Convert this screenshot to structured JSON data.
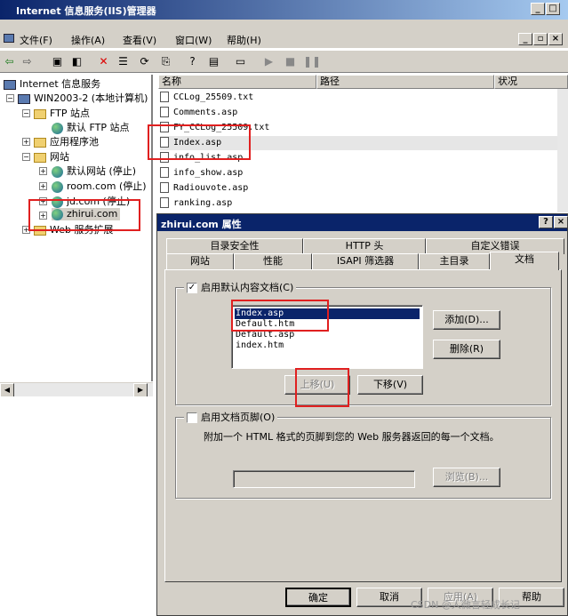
{
  "window": {
    "title": "Internet 信息服务(IIS)管理器"
  },
  "menu": [
    "文件(F)",
    "操作(A)",
    "查看(V)",
    "窗口(W)",
    "帮助(H)"
  ],
  "tree": {
    "root": "Internet 信息服务",
    "computer": "WIN2003-2 (本地计算机)",
    "ftp": "FTP 站点",
    "ftp_default": "默认 FTP 站点",
    "app_pools": "应用程序池",
    "websites": "网站",
    "sites": [
      "默认网站 (停止)",
      "room.com (停止)",
      "jd.com (停止)",
      "zhirui.com"
    ],
    "ext": "Web 服务扩展"
  },
  "list": {
    "columns": [
      "名称",
      "路径",
      "状况"
    ],
    "files": [
      "CCLog_25509.txt",
      "Comments.asp",
      "FY_CCLog_25509.txt",
      "Index.asp",
      "info_list.asp",
      "info_show.asp",
      "Radiouvote.asp",
      "ranking.asp"
    ]
  },
  "dialog": {
    "title": "zhirui.com 属性",
    "tabs_row1": [
      "目录安全性",
      "HTTP 头",
      "自定义错误"
    ],
    "tabs_row2": [
      "网站",
      "性能",
      "ISAPI 筛选器",
      "主目录",
      "文档"
    ],
    "enable_default_label": "启用默认内容文档(C)",
    "default_docs": [
      "Index.asp",
      "Default.htm",
      "Default.asp",
      "index.htm"
    ],
    "add_button": "添加(D)...",
    "remove_button": "删除(R)",
    "move_up_button": "上移(U)",
    "move_down_button": "下移(V)",
    "footer_label": "启用文档页脚(O)",
    "footer_desc": "附加一个 HTML 格式的页脚到您的 Web 服务器返回的每一个文档。",
    "browse_button": "浏览(B)...",
    "ok_button": "确定",
    "cancel_button": "取消",
    "apply_button": "应用(A)",
    "help_button": "帮助"
  },
  "watermark": "CSDN @人微言轻成长记"
}
